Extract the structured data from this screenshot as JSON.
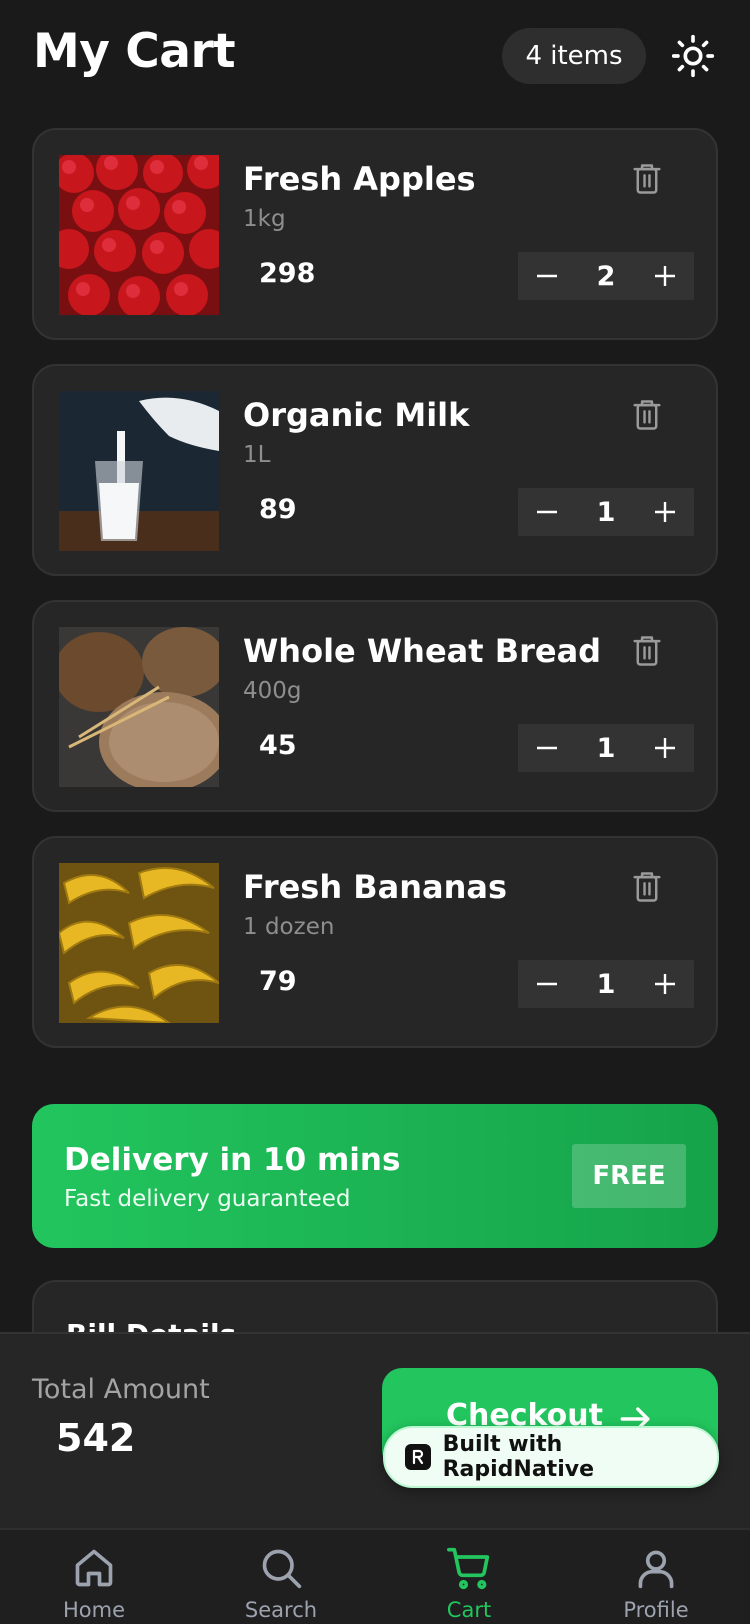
{
  "header": {
    "title": "My Cart",
    "item_count": "4 items",
    "theme_icon": "sun-icon"
  },
  "cart": {
    "items": [
      {
        "name": "Fresh Apples",
        "size": "1kg",
        "price": "298",
        "quantity": "2",
        "image": "apples-image"
      },
      {
        "name": "Organic Milk",
        "size": "1L",
        "price": "89",
        "quantity": "1",
        "image": "milk-image"
      },
      {
        "name": "Whole Wheat Bread",
        "size": "400g",
        "price": "45",
        "quantity": "1",
        "image": "bread-image"
      },
      {
        "name": "Fresh Bananas",
        "size": "1 dozen",
        "price": "79",
        "quantity": "1",
        "image": "bananas-image"
      }
    ]
  },
  "delivery": {
    "title": "Delivery in 10 mins",
    "subtitle": "Fast delivery guaranteed",
    "badge": "FREE"
  },
  "bill": {
    "title": "Bill Details"
  },
  "footer": {
    "total_label": "Total Amount",
    "total_value": "542",
    "checkout_label": "Checkout"
  },
  "badge": {
    "text": "Built with RapidNative"
  },
  "tabs": [
    {
      "label": "Home",
      "icon": "home-icon"
    },
    {
      "label": "Search",
      "icon": "search-icon"
    },
    {
      "label": "Cart",
      "icon": "cart-icon",
      "active": true
    },
    {
      "label": "Profile",
      "icon": "profile-icon"
    }
  ],
  "colors": {
    "background": "#1a1a1a",
    "card": "#262626",
    "accent": "#22c55e",
    "muted_text": "#8e8e8e"
  }
}
